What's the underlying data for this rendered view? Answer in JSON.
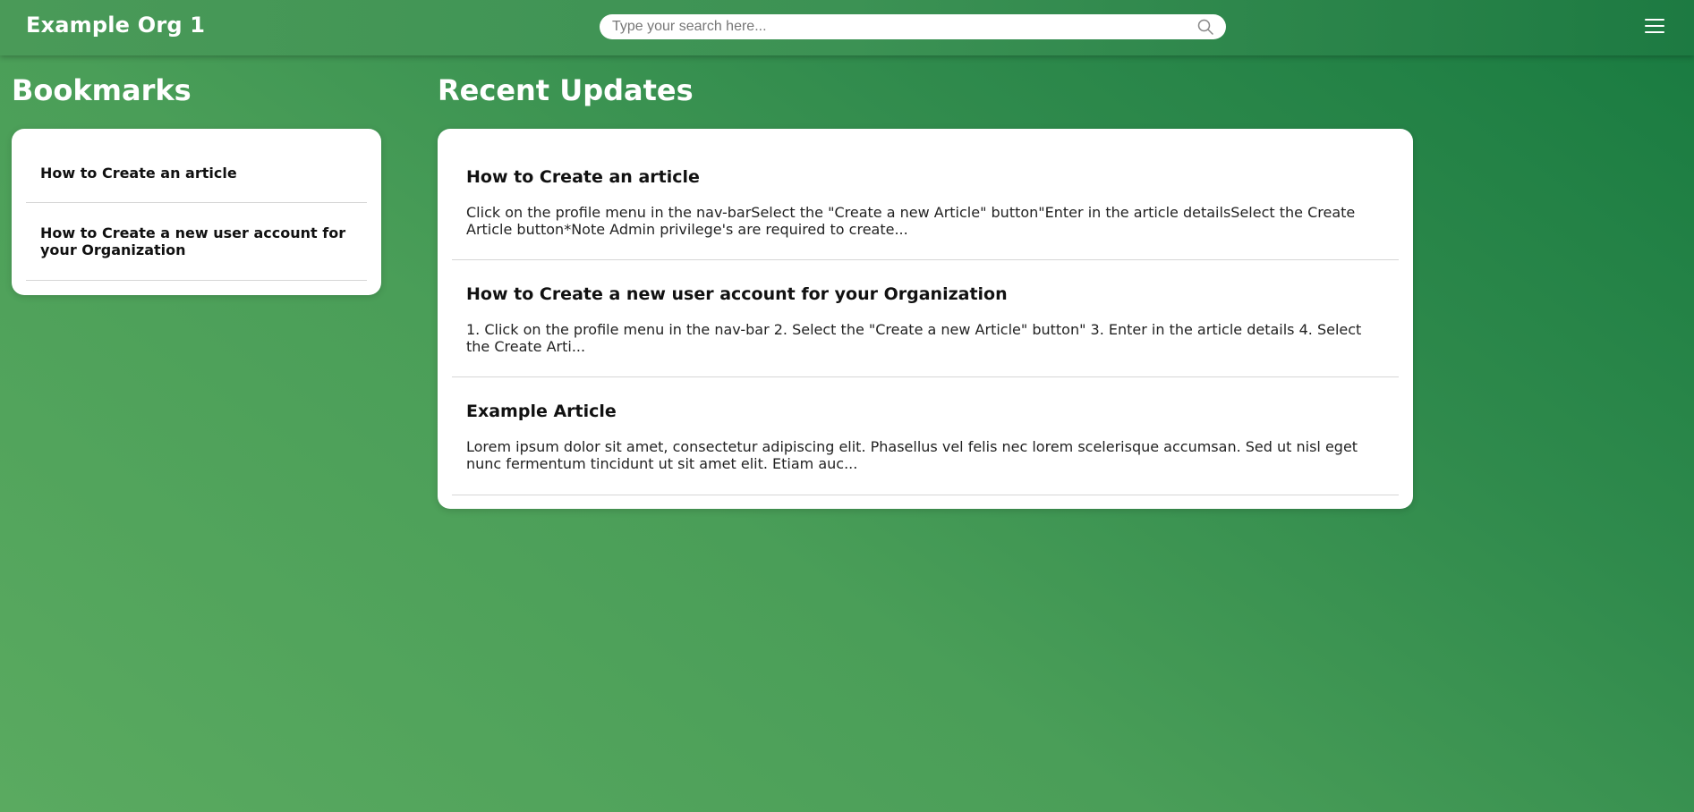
{
  "header": {
    "org_name": "Example Org 1",
    "search_placeholder": "Type your search here..."
  },
  "bookmarks": {
    "title": "Bookmarks",
    "items": [
      {
        "label": "How to Create an article"
      },
      {
        "label": "How to Create a new user account for your Organization"
      }
    ]
  },
  "updates": {
    "title": "Recent Updates",
    "items": [
      {
        "title": "How to Create an article",
        "excerpt": "Click on the profile menu in the nav-barSelect the \"Create a new Article\" button\"Enter in the article detailsSelect the Create Article button*Note Admin privilege's are required to create..."
      },
      {
        "title": "How to Create a new user account for your Organization",
        "excerpt": "1. Click on the profile menu in the nav-bar 2. Select the \"Create a new Article\" button\" 3. Enter in the article details 4. Select the Create Arti..."
      },
      {
        "title": "Example Article",
        "excerpt": "Lorem ipsum dolor sit amet, consectetur adipiscing elit. Phasellus vel felis nec lorem scelerisque accumsan. Sed ut nisl eget nunc fermentum tincidunt ut sit amet elit. Etiam auc..."
      }
    ]
  },
  "icons": {
    "search": "search-icon",
    "menu": "hamburger-menu-icon"
  },
  "colors": {
    "accent": "#2f8a4c",
    "card": "#ffffff"
  }
}
